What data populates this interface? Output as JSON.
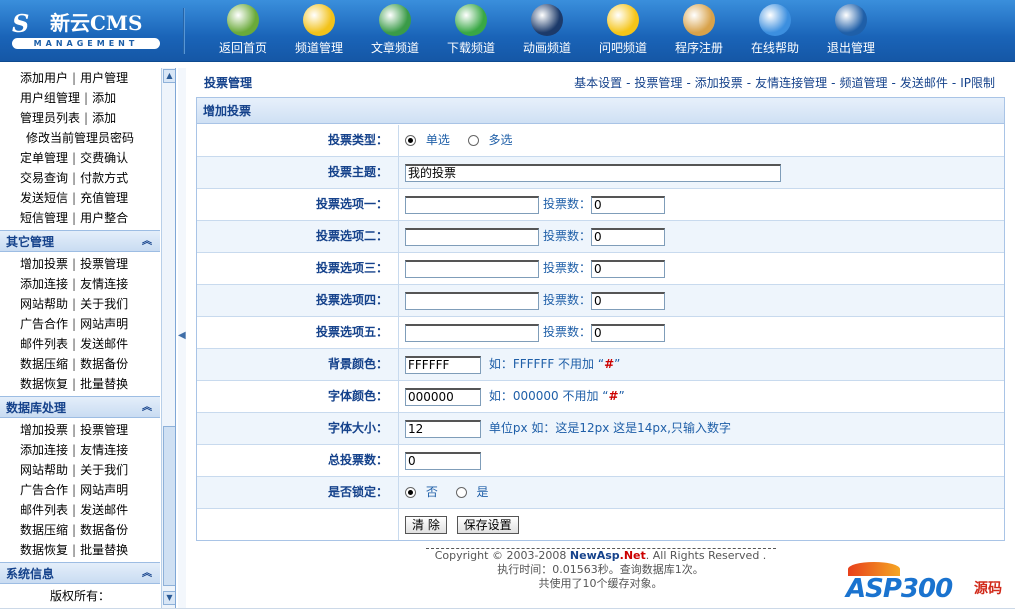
{
  "header": {
    "logo_mark": "S",
    "logo_title": "新云CMS",
    "logo_sub": "MANAGEMENT",
    "nav": [
      {
        "label": "返回首页",
        "icon": "home-icon",
        "color": "#6aaa3a"
      },
      {
        "label": "频道管理",
        "icon": "channel-icon",
        "color": "#f2c21a"
      },
      {
        "label": "文章频道",
        "icon": "article-icon",
        "color": "#3a9b48"
      },
      {
        "label": "下载频道",
        "icon": "download-icon",
        "color": "#39a845"
      },
      {
        "label": "动画频道",
        "icon": "flash-icon",
        "color": "#1c3a6a"
      },
      {
        "label": "问吧频道",
        "icon": "question-icon",
        "color": "#f5c518"
      },
      {
        "label": "程序注册",
        "icon": "tools-icon",
        "color": "#d8a24a"
      },
      {
        "label": "在线帮助",
        "icon": "help-icon",
        "color": "#3c8fdf"
      },
      {
        "label": "退出管理",
        "icon": "power-icon",
        "color": "#1f5fa8"
      }
    ]
  },
  "sidebar": {
    "top_rows": [
      [
        "添加用户",
        "用户管理"
      ],
      [
        "用户组管理",
        "添加"
      ],
      [
        "管理员列表",
        "添加"
      ],
      [
        "修改当前管理员密码"
      ],
      [
        "定单管理",
        "交费确认"
      ],
      [
        "交易查询",
        "付款方式"
      ],
      [
        "发送短信",
        "充值管理"
      ],
      [
        "短信管理",
        "用户整合"
      ]
    ],
    "sections": [
      {
        "title": "其它管理",
        "rows": [
          [
            "增加投票",
            "投票管理"
          ],
          [
            "添加连接",
            "友情连接"
          ],
          [
            "网站帮助",
            "关于我们"
          ],
          [
            "广告合作",
            "网站声明"
          ],
          [
            "邮件列表",
            "发送邮件"
          ],
          [
            "数据压缩",
            "数据备份"
          ],
          [
            "数据恢复",
            "批量替换"
          ]
        ]
      },
      {
        "title": "数据库处理",
        "rows": [
          [
            "增加投票",
            "投票管理"
          ],
          [
            "添加连接",
            "友情连接"
          ],
          [
            "网站帮助",
            "关于我们"
          ],
          [
            "广告合作",
            "网站声明"
          ],
          [
            "邮件列表",
            "发送邮件"
          ],
          [
            "数据压缩",
            "数据备份"
          ],
          [
            "数据恢复",
            "批量替换"
          ]
        ]
      },
      {
        "title": "系统信息",
        "rows": [
          [
            "版权所有："
          ]
        ]
      }
    ]
  },
  "breadcrumb": {
    "title": "投票管理",
    "links": [
      "基本设置",
      "投票管理",
      "添加投票",
      "友情连接管理",
      "频道管理",
      "发送邮件",
      "IP限制"
    ]
  },
  "form": {
    "heading": "增加投票",
    "vote_type_label": "投票类型：",
    "single_label": "单选",
    "multi_label": "多选",
    "subject_label": "投票主题：",
    "subject_value": "我的投票",
    "options": [
      {
        "label": "投票选项一：",
        "count_label": "投票数：",
        "count": "0"
      },
      {
        "label": "投票选项二：",
        "count_label": "投票数：",
        "count": "0"
      },
      {
        "label": "投票选项三：",
        "count_label": "投票数：",
        "count": "0"
      },
      {
        "label": "投票选项四：",
        "count_label": "投票数：",
        "count": "0"
      },
      {
        "label": "投票选项五：",
        "count_label": "投票数：",
        "count": "0"
      }
    ],
    "bg_color_label": "背景颜色：",
    "bg_color_value": "FFFFFF",
    "bg_color_hint": "如：FFFFFF 不用加 “",
    "font_color_label": "字体颜色：",
    "font_color_value": "000000",
    "font_color_hint": "如：000000 不用加 “",
    "hash_mark": "#",
    "close_quote": "”",
    "font_size_label": "字体大小：",
    "font_size_value": "12",
    "font_size_hint": "单位px 如：这是12px 这是14px,只输入数字",
    "total_label": "总投票数：",
    "total_value": "0",
    "lock_label": "是否锁定：",
    "lock_no": "否",
    "lock_yes": "是",
    "clear_button": "清 除",
    "save_button": "保存设置"
  },
  "footer": {
    "copy_prefix": "Copyright © 2003-2008",
    "brand_a": "NewAsp",
    "brand_b": ".Net",
    "copy_suffix": ". All Rights Reserved .",
    "exec_time": "执行时间：0.01563秒。查询数据库1次。",
    "cache": "共使用了10个缓存对象。"
  },
  "watermark": {
    "text": "ASP300",
    "tag": "源码"
  }
}
